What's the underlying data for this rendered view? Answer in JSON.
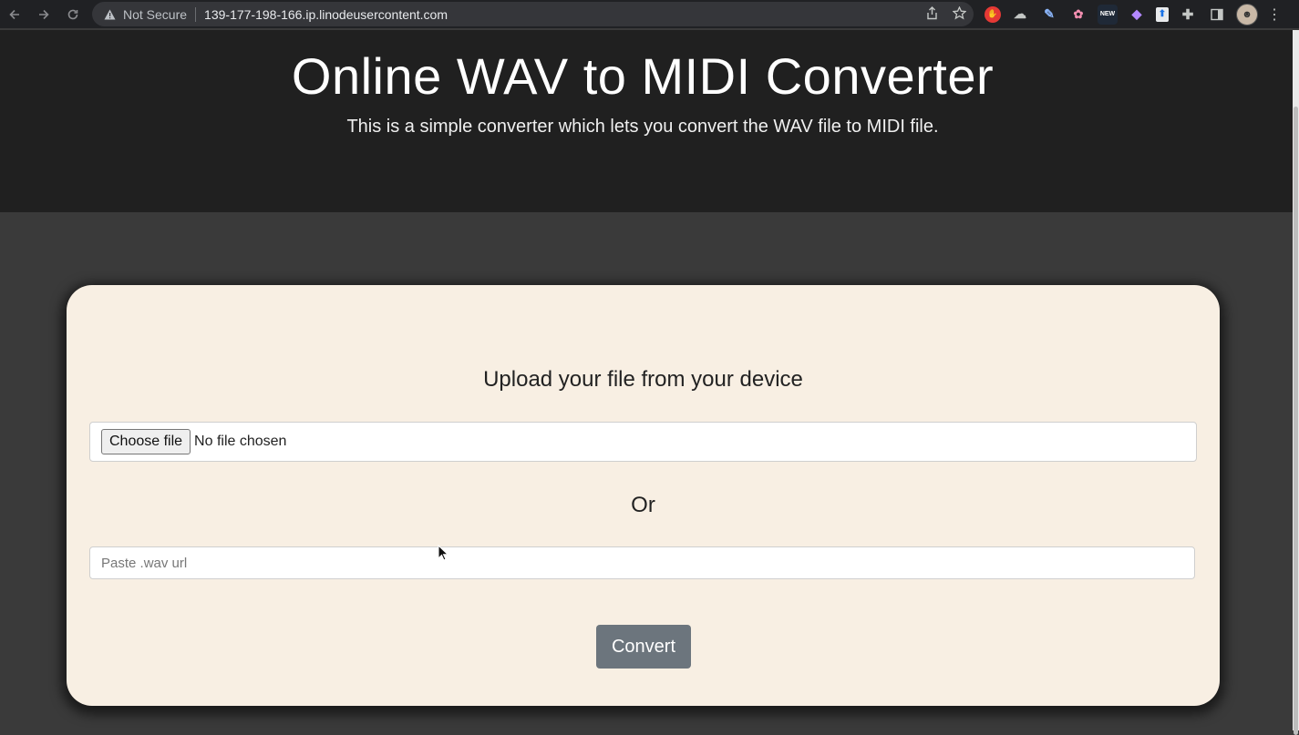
{
  "browser": {
    "security_label": "Not Secure",
    "url": "139-177-198-166.ip.linodeusercontent.com",
    "extensions": [
      {
        "name": "stop-extension-icon",
        "color": "#e53935",
        "glyph": "✋"
      },
      {
        "name": "cloud-extension-icon",
        "color": "#5f6368",
        "glyph": "☁"
      },
      {
        "name": "pen-extension-icon",
        "color": "#4285f4",
        "glyph": "✎"
      },
      {
        "name": "brain-extension-icon",
        "color": "#e91e63",
        "glyph": "✿"
      },
      {
        "name": "new-extension-icon",
        "color": "#1a73e8",
        "glyph": "NEW"
      },
      {
        "name": "drop-extension-icon",
        "color": "#7e57c2",
        "glyph": "◆"
      },
      {
        "name": "upload-extension-icon",
        "color": "#3c78d8",
        "glyph": "⬆"
      }
    ]
  },
  "hero": {
    "title": "Online WAV to MIDI Converter",
    "subtitle": "This is a simple converter which lets you convert the WAV file to MIDI file."
  },
  "form": {
    "upload_heading": "Upload your file from your device",
    "choose_file_label": "Choose file",
    "file_status": "No file chosen",
    "or_text": "Or",
    "url_placeholder": "Paste .wav url",
    "url_value": "",
    "convert_label": "Convert"
  },
  "colors": {
    "hero_bg": "#202020",
    "page_bg": "#3a3a3a",
    "card_bg": "#f8efe3",
    "button_bg": "#6c757d"
  }
}
